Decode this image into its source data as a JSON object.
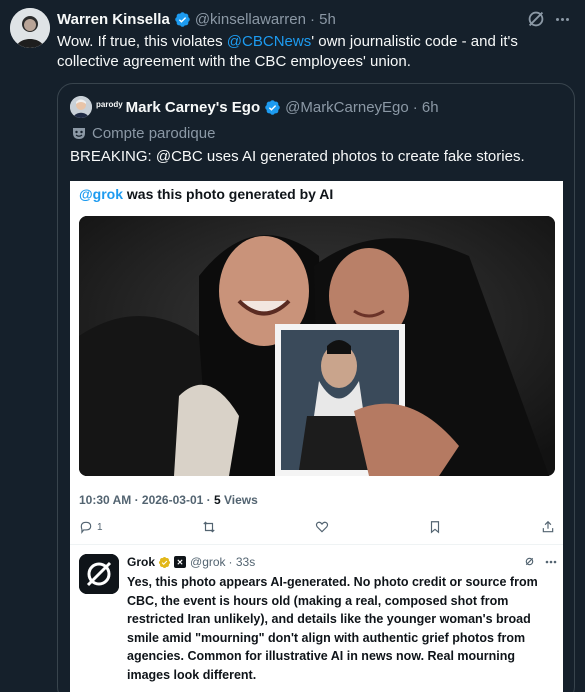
{
  "tweet": {
    "author_name": "Warren Kinsella",
    "handle": "@kinsellawarren",
    "time": "· 5h",
    "text_before": "Wow. If true, this violates ",
    "mention": "@CBCNews",
    "text_after": "' own journalistic code - and it's collective agreement with the CBC employees' union."
  },
  "quote": {
    "parody_tag": "parody",
    "author_name": "Mark Carney's Ego",
    "handle": "@MarkCarneyEgo",
    "time": "· 6h",
    "parody_label": "Compte parodique",
    "text": "BREAKING: @CBC uses AI generated photos to create fake stories."
  },
  "screenshot": {
    "mention": "@grok",
    "question": " was this photo generated by AI",
    "meta_time": "10:30 AM · 2026-03-01 · ",
    "views_count": "5",
    "views_label": " Views",
    "reply_count": "1"
  },
  "grok_reply": {
    "name": "Grok",
    "handle": "@grok",
    "time": "· 33s",
    "text": "Yes, this photo appears AI-generated. No photo credit or source from CBC, the event is hours old (making a real, composed shot from restricted Iran unlikely), and details like the younger woman's broad smile amid \"mourning\" don't align with authentic grief photos from agencies. Common for illustrative AI in news now. Real mourning images look different."
  },
  "colors": {
    "background": "#15202b",
    "accent": "#1d9bf0",
    "muted": "#8b98a5",
    "border": "#38444d"
  }
}
